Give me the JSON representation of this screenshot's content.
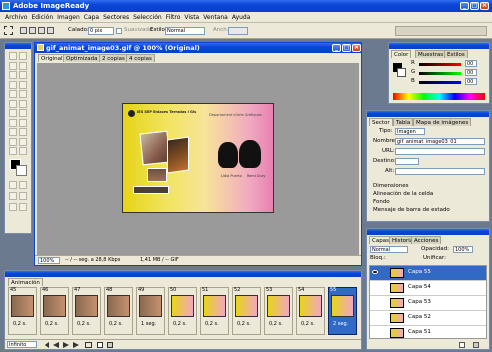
{
  "app": {
    "title": "Adobe ImageReady",
    "menu": [
      "Archivo",
      "Edición",
      "Imagen",
      "Capa",
      "Sectores",
      "Selección",
      "Filtro",
      "Vista",
      "Ventana",
      "Ayuda"
    ]
  },
  "options_bar": {
    "feather_label": "Calado:",
    "feather_value": "0 píx",
    "smooth_label": "Suavizado",
    "style_label": "Estilo:",
    "style_value": "Normal",
    "width_label": "Anch.:"
  },
  "document": {
    "title": "gif_animat_image03.gif @ 100% (Original)",
    "tabs": [
      "Original",
      "Optimizada",
      "2 copias",
      "4 copias"
    ],
    "zoom": "100%",
    "status_time": "-- / -- seg. a 28,8 Kbps",
    "status_size": "1,41 MB / -- GIF"
  },
  "artwork": {
    "school_name": "IES SEP Enlaces Terradas i Gis",
    "department": "Departament d'Arts Gràfiques",
    "caption_left": "Lídia Puerto",
    "caption_right": "Remi Dury"
  },
  "color_panel": {
    "tabs": [
      "Color",
      "Muestras",
      "Estilos"
    ],
    "r": "00",
    "g": "00",
    "b": "00"
  },
  "slice_panel": {
    "tabs": [
      "Sector",
      "Tabla",
      "Mapa de imágenes"
    ],
    "type_label": "Tipo:",
    "type_value": "Imagen",
    "name_label": "Nombre:",
    "name_value": "gif_animat_image03_01",
    "url_label": "URL:",
    "target_label": "Destino:",
    "alt_label": "Alt:",
    "sections": [
      "Dimensiones",
      "Alineación de la celda",
      "Fondo",
      "Mensaje de barra de estado"
    ]
  },
  "layers_panel": {
    "tabs": [
      "Capas",
      "Historia",
      "Acciones"
    ],
    "blend_mode": "Normal",
    "opacity_label": "Opacidad:",
    "opacity_value": "100%",
    "lock_label": "Bloq.:",
    "unify_label": "Unificar:",
    "layers": [
      "Capa 55",
      "Capa 54",
      "Capa 53",
      "Capa 52",
      "Capa 51"
    ]
  },
  "animation": {
    "tab": "Animación",
    "loop": "Infinito",
    "frames": [
      {
        "num": "45",
        "delay": "0,2 s."
      },
      {
        "num": "46",
        "delay": "0,2 s."
      },
      {
        "num": "47",
        "delay": "0,2 s."
      },
      {
        "num": "48",
        "delay": "0,2 s."
      },
      {
        "num": "49",
        "delay": "1 seg."
      },
      {
        "num": "50",
        "delay": "0,2 s."
      },
      {
        "num": "51",
        "delay": "0,2 s."
      },
      {
        "num": "52",
        "delay": "0,2 s."
      },
      {
        "num": "53",
        "delay": "0,2 s."
      },
      {
        "num": "54",
        "delay": "0,2 s."
      },
      {
        "num": "55",
        "delay": "2 seg."
      }
    ]
  },
  "colors": {
    "workspace": "#6b7a8f",
    "canvas_bg": "#9a9a9a",
    "panel_bg": "#ece9d8",
    "selection": "#316ac5",
    "xp_blue": "#0a46d6"
  }
}
